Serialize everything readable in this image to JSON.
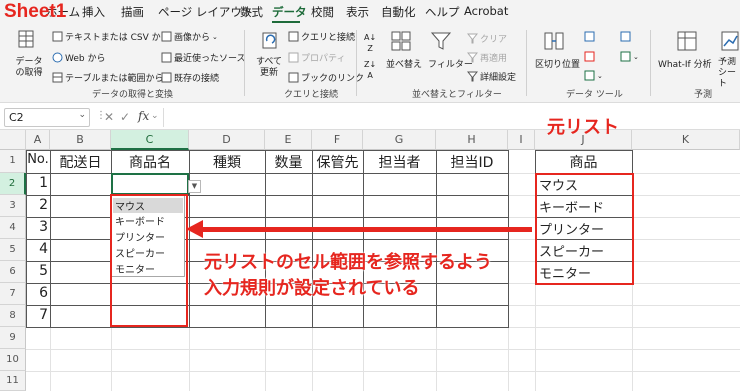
{
  "annotation": {
    "sheet_label": "Sheet1",
    "source_list_label": "元リスト",
    "callout_line1": "元リストのセル範囲を参照するよう",
    "callout_line2": "入力規則が設定されている"
  },
  "menu": {
    "items": [
      "ホーム",
      "挿入",
      "描画",
      "ページ レイアウト",
      "数式",
      "データ",
      "校閲",
      "表示",
      "自動化",
      "ヘルプ",
      "Acrobat"
    ],
    "active": "データ"
  },
  "ribbon": {
    "get_data": {
      "big_button": "データの取得",
      "text_csv": "テキストまたは CSV から",
      "web": "Web から",
      "table_range": "テーブルまたは範囲から",
      "from_image": "画像から",
      "recent_sources": "最近使ったソース",
      "existing_conn": "既存の接続",
      "group_label": "データの取得と変換"
    },
    "queries": {
      "refresh_all": "すべて更新",
      "queries_conn": "クエリと接続",
      "properties": "プロパティ",
      "edit_links": "ブックのリンク",
      "group_label": "クエリと接続"
    },
    "sort_filter": {
      "sort": "並べ替え",
      "filter": "フィルター",
      "clear": "クリア",
      "reapply": "再適用",
      "advanced": "詳細設定",
      "group_label": "並べ替えとフィルター"
    },
    "data_tools": {
      "text_to_columns": "区切り位置",
      "group_label": "データ ツール"
    },
    "forecast": {
      "what_if": "What-If 分析",
      "forecast_sheet": "予測シート",
      "group_label": "予測"
    }
  },
  "formula_bar": {
    "name_box": "C2",
    "fx": "fx",
    "content": ""
  },
  "columns": [
    "A",
    "B",
    "C",
    "D",
    "E",
    "F",
    "G",
    "H",
    "I",
    "J",
    "K"
  ],
  "rows": [
    "1",
    "2",
    "3",
    "4",
    "5",
    "6",
    "7",
    "8",
    "9",
    "10",
    "11"
  ],
  "table": {
    "headers": [
      "No.",
      "配送日",
      "商品名",
      "種類",
      "数量",
      "保管先",
      "担当者",
      "担当ID"
    ],
    "numbers": [
      "1",
      "2",
      "3",
      "4",
      "5",
      "6",
      "7"
    ]
  },
  "source_list": {
    "header": "商品",
    "items": [
      "マウス",
      "キーボード",
      "プリンター",
      "スピーカー",
      "モニター"
    ]
  },
  "dropdown": {
    "items": [
      "マウス",
      "キーボード",
      "プリンター",
      "スピーカー",
      "モニター"
    ],
    "highlighted": "マウス"
  },
  "colors": {
    "excel_green": "#1e7145",
    "annotation_red": "#e6261f"
  }
}
